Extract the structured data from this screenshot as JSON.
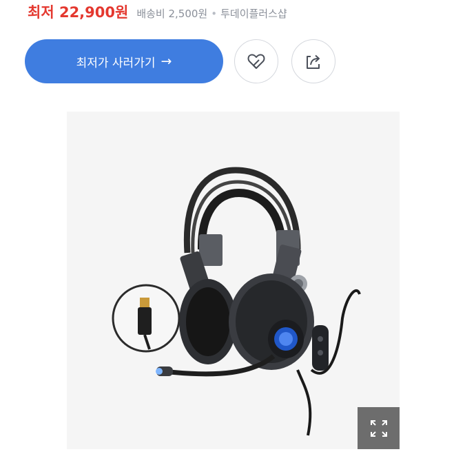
{
  "price": {
    "label": "최저 22,900원",
    "color": "#e4382f"
  },
  "shipping": {
    "text": "배송비 2,500원",
    "separator": "•",
    "seller": "투데이플러스샵"
  },
  "actions": {
    "buy_label": "최저가 사러가기",
    "buy_arrow": "→",
    "accent": "#3f7de0",
    "wishlist_icon": "heart-icon",
    "share_icon": "share-icon"
  },
  "image": {
    "subject": "headset-icon",
    "expand_icon": "expand-icon"
  }
}
